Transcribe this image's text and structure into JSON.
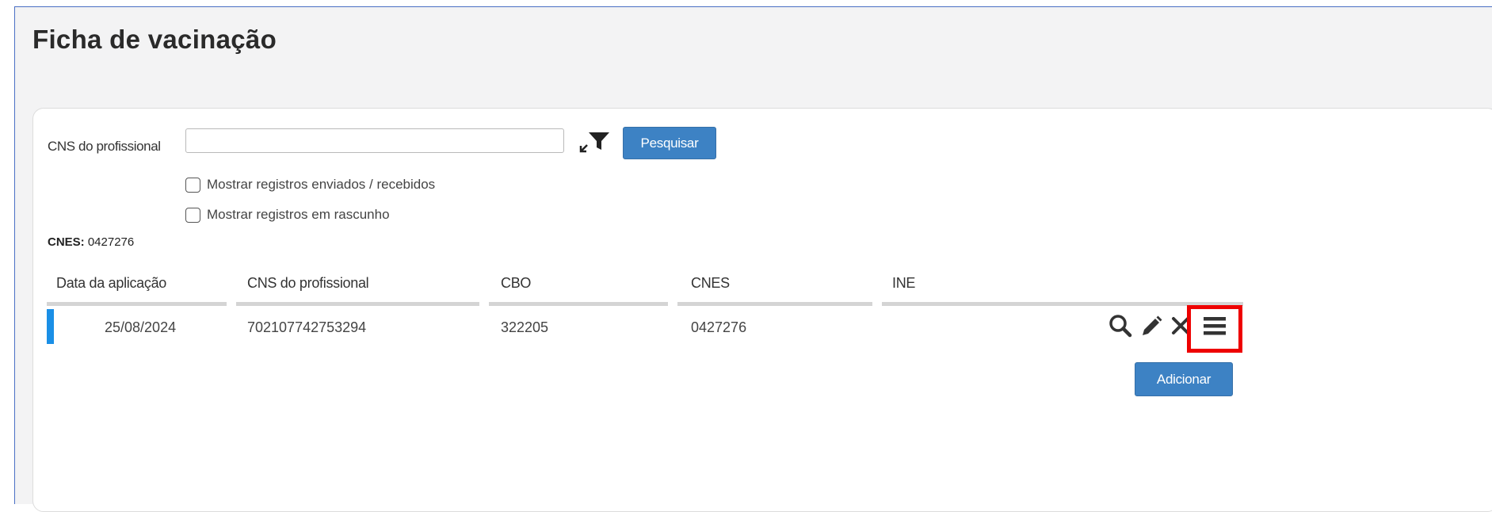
{
  "page": {
    "title": "Ficha de vacinação"
  },
  "search": {
    "cns_label": "CNS do profissional",
    "cns_value": "",
    "search_button": "Pesquisar",
    "filter_icon": "filter-expand-icon",
    "checkboxes": [
      {
        "label": "Mostrar registros enviados / recebidos",
        "checked": false
      },
      {
        "label": "Mostrar registros em rascunho",
        "checked": false
      }
    ]
  },
  "cnes_info": {
    "label": "CNES:",
    "value": "0427276"
  },
  "table": {
    "columns": [
      "Data da aplicação",
      "CNS do profissional",
      "CBO",
      "CNES",
      "INE"
    ],
    "rows": [
      {
        "data_aplicacao": "25/08/2024",
        "cns_profissional": "702107742753294",
        "cbo": "322205",
        "cnes": "0427276",
        "ine": ""
      }
    ],
    "row_actions": [
      "search-icon",
      "pencil-icon",
      "close-icon",
      "menu-icon"
    ]
  },
  "add_button": "Adicionar",
  "colors": {
    "accent": "#3d82c4",
    "row_marker": "#1a8fe6",
    "highlight": "#ee0000"
  }
}
